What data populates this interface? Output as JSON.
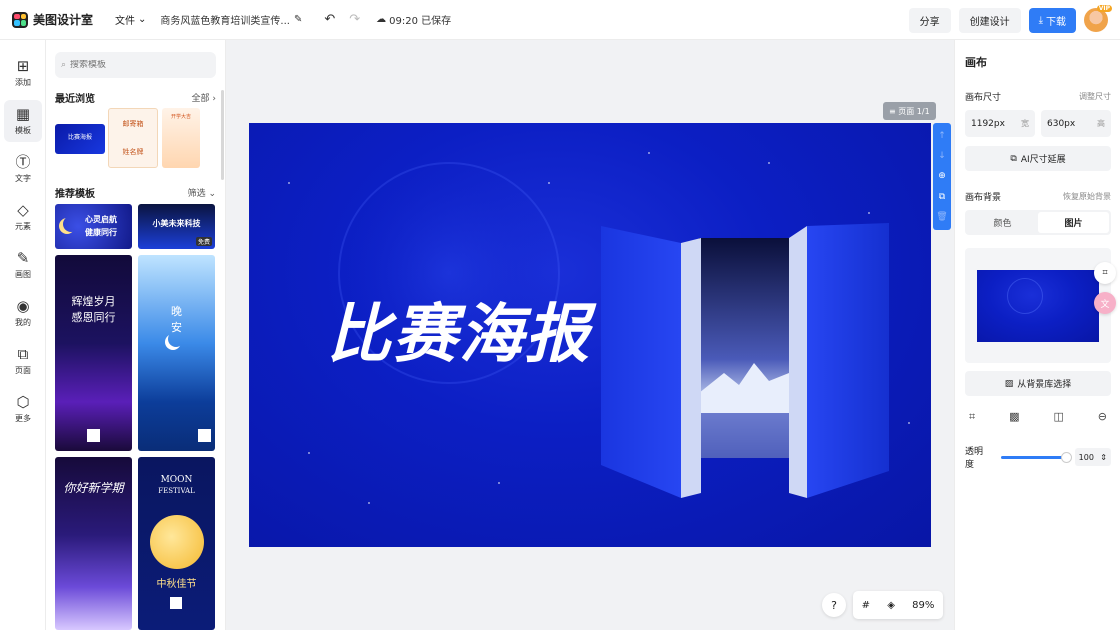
{
  "header": {
    "app_name": "美图设计室",
    "file_menu": "文件",
    "doc_title": "商务风蓝色教育培训类宣传...",
    "save_status": "09:20 已保存",
    "share": "分享",
    "create": "创建设计",
    "download": "下载",
    "vip_badge": "VIP"
  },
  "rail": [
    {
      "label": "添加",
      "icon": "plus-square-icon"
    },
    {
      "label": "模板",
      "icon": "template-icon"
    },
    {
      "label": "文字",
      "icon": "text-icon"
    },
    {
      "label": "元素",
      "icon": "shapes-icon"
    },
    {
      "label": "画图",
      "icon": "draw-icon"
    },
    {
      "label": "我的",
      "icon": "user-icon"
    },
    {
      "label": "页面",
      "icon": "page-add-icon"
    },
    {
      "label": "更多",
      "icon": "cube-icon"
    }
  ],
  "panel": {
    "search_placeholder": "搜索模板",
    "recent_title": "最近浏览",
    "recent_link": "全部",
    "recommend_title": "推荐模板",
    "recommend_link": "筛选",
    "recent_thumb_1_a": "比赛海报",
    "recent_thumb_2_a": "邮寄箱",
    "recent_thumb_2_b": "姓名牌",
    "recent_thumb_3_a": "开学大吉",
    "tpl1_a": "心灵启航",
    "tpl1_b": "健康同行",
    "tpl2_a": "小美未来科技",
    "tpl2_b": "免费",
    "tpl3_a": "辉煌岁月",
    "tpl3_b": "感恩同行",
    "tpl4_a": "晚",
    "tpl4_b": "安",
    "tpl5_a": "你好新学期",
    "tpl6_a": "MOON",
    "tpl6_b": "FESTIVAL",
    "tpl6_c": "中秋佳节"
  },
  "canvas": {
    "page_tag": "页面 1/1",
    "headline": "比赛海报",
    "zoom": "89%",
    "help": "?",
    "background_color": "#0c1fc4"
  },
  "right": {
    "title": "画布",
    "size_label": "画布尺寸",
    "size_link": "调整尺寸",
    "width_value": "1192px",
    "width_unit": "宽",
    "height_value": "630px",
    "height_unit": "高",
    "ai_expand": "AI尺寸延展",
    "bg_label": "画布背景",
    "bg_link": "恢复原始背景",
    "seg_color": "颜色",
    "seg_image": "图片",
    "bg_library": "从背景库选择",
    "opacity_label": "透明度",
    "opacity_value": "100"
  },
  "accent_color": "#2f7cf6"
}
